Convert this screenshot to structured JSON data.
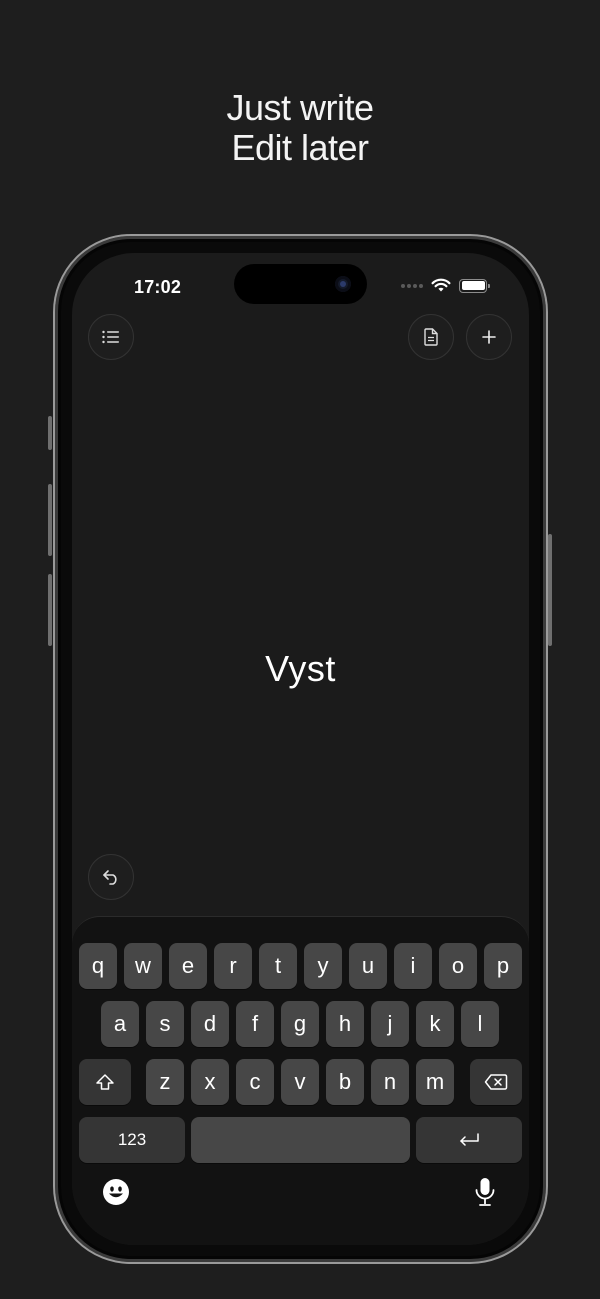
{
  "headline": {
    "line1": "Just write",
    "line2": "Edit later"
  },
  "status_bar": {
    "time": "17:02",
    "wifi_icon": "wifi-icon",
    "battery_icon": "battery-icon"
  },
  "toolbar": {
    "menu_icon": "list-icon",
    "document_icon": "document-icon",
    "new_icon": "plus-icon",
    "undo_icon": "undo-icon"
  },
  "editor": {
    "text": "Vyst"
  },
  "keyboard": {
    "row1": [
      "q",
      "w",
      "e",
      "r",
      "t",
      "y",
      "u",
      "i",
      "o",
      "p"
    ],
    "row2": [
      "a",
      "s",
      "d",
      "f",
      "g",
      "h",
      "j",
      "k",
      "l"
    ],
    "row3": [
      "z",
      "x",
      "c",
      "v",
      "b",
      "n",
      "m"
    ],
    "numbers_label": "123",
    "shift_icon": "shift-icon",
    "delete_icon": "delete-icon",
    "return_icon": "return-icon",
    "emoji_icon": "emoji-icon",
    "mic_icon": "microphone-icon"
  }
}
